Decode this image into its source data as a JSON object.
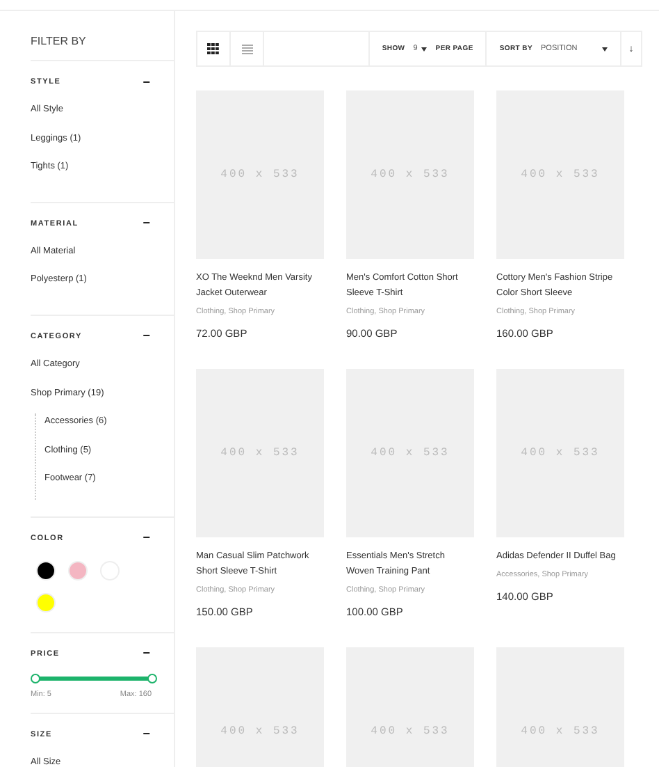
{
  "sidebar": {
    "title": "FILTER BY",
    "sections": [
      {
        "kind": "list",
        "title": "STYLE",
        "toggle": "−",
        "items": [
          {
            "label": "All Style"
          },
          {
            "label": "Leggings (1)"
          },
          {
            "label": "Tights (1)"
          }
        ]
      },
      {
        "kind": "list",
        "title": "MATERIAL",
        "toggle": "−",
        "items": [
          {
            "label": "All Material"
          },
          {
            "label": "Polyesterp (1)"
          }
        ]
      },
      {
        "kind": "list",
        "title": "CATEGORY",
        "toggle": "−",
        "items": [
          {
            "label": "All Category"
          },
          {
            "label": "Shop Primary (19)",
            "children": [
              {
                "label": "Accessories (6)"
              },
              {
                "label": "Clothing (5)"
              },
              {
                "label": "Footwear (7)"
              }
            ]
          }
        ]
      },
      {
        "kind": "colors",
        "title": "COLOR",
        "toggle": "−",
        "swatches": [
          {
            "color": "#000000"
          },
          {
            "color": "#f4b6c2"
          },
          {
            "color": "#ffffff"
          },
          {
            "color": "#ffff00"
          }
        ]
      },
      {
        "kind": "price",
        "title": "PRICE",
        "toggle": "−",
        "thumbs": [
          {
            "level": 0
          },
          {
            "level": 1
          }
        ],
        "min": "Min: 5",
        "max": "Max: 160"
      },
      {
        "kind": "list",
        "title": "SIZE",
        "toggle": "−",
        "items": [
          {
            "label": "All Size"
          }
        ]
      }
    ]
  },
  "toolbar": {
    "views": [
      {
        "kind": "grid",
        "selected": true
      },
      {
        "kind": "list",
        "selected": false
      }
    ],
    "show_label": "SHOW",
    "per_page": "9",
    "per_page_label": "PER PAGE",
    "sort_label": "SORT BY",
    "sort_value": "POSITION",
    "sort_direction": "↓"
  },
  "products": [
    {
      "image_text": "400 x 533",
      "name": "XO The Weeknd Men Varsity Jacket Outerwear",
      "categories": "Clothing, Shop Primary",
      "price": "72.00 GBP"
    },
    {
      "image_text": "400 x 533",
      "name": "Men's Comfort Cotton Short Sleeve T-Shirt",
      "categories": "Clothing, Shop Primary",
      "price": "90.00 GBP"
    },
    {
      "image_text": "400 x 533",
      "name": "Cottory Men's Fashion Stripe Color Short Sleeve",
      "categories": "Clothing, Shop Primary",
      "price": "160.00 GBP"
    },
    {
      "image_text": "400 x 533",
      "name": "Man Casual Slim Patchwork Short Sleeve T-Shirt",
      "categories": "Clothing, Shop Primary",
      "price": "150.00 GBP"
    },
    {
      "image_text": "400 x 533",
      "name": "Essentials Men's Stretch Woven Training Pant",
      "categories": "Clothing, Shop Primary",
      "price": "100.00 GBP"
    },
    {
      "image_text": "400 x 533",
      "name": "Adidas Defender II Duffel Bag",
      "categories": "Accessories, Shop Primary",
      "price": "140.00 GBP"
    },
    {
      "image_text": "400 x 533"
    },
    {
      "image_text": "400 x 533"
    },
    {
      "image_text": "400 x 533"
    }
  ]
}
